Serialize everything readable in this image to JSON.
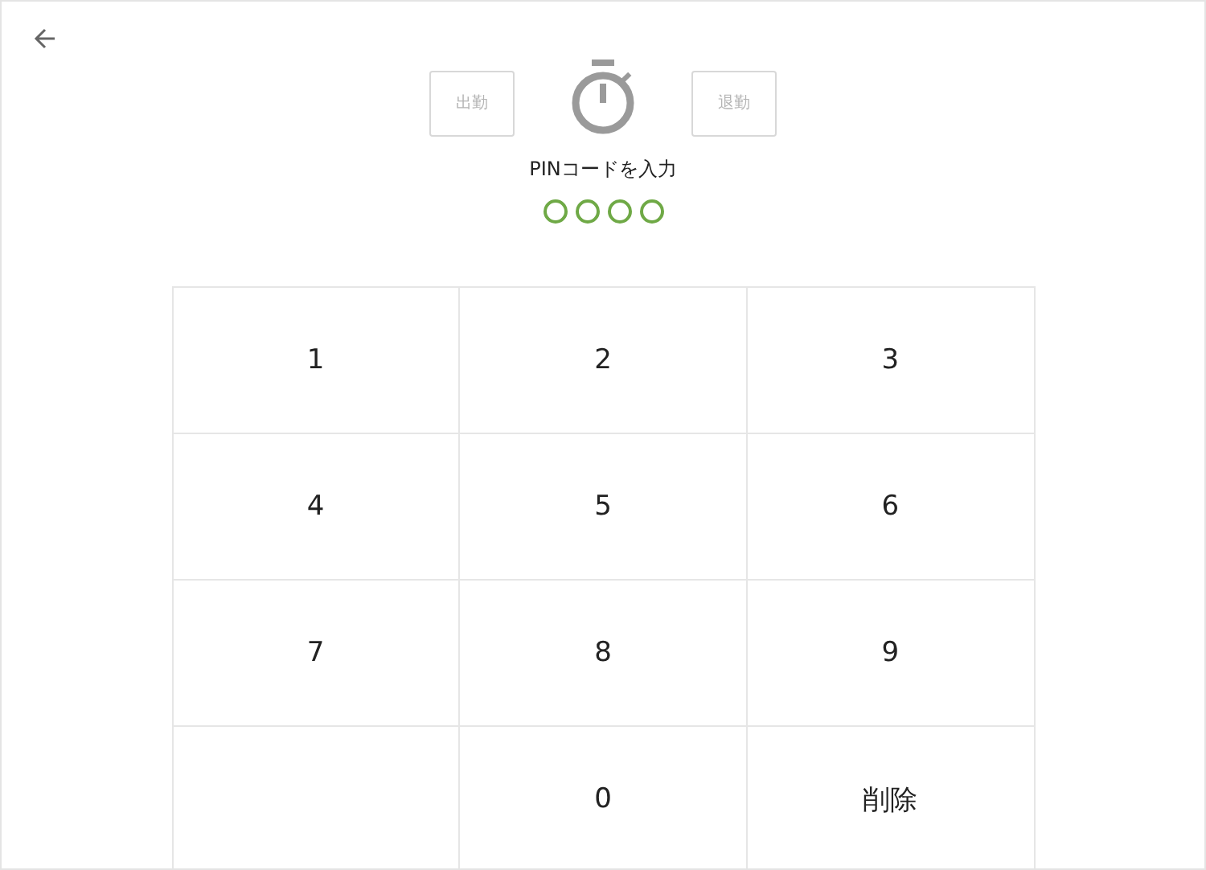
{
  "header": {
    "back": {
      "kind": "arrow"
    },
    "buttons": [
      {
        "label": "出勤",
        "disabled": true
      },
      {
        "label": "退勤",
        "disabled": true
      }
    ]
  },
  "prompt": "PINコードを入力",
  "pin_dots": [
    {
      "filled": false
    },
    {
      "filled": false
    },
    {
      "filled": false
    },
    {
      "filled": false
    }
  ],
  "keypad": [
    {
      "kind": "key",
      "label": "1"
    },
    {
      "kind": "key",
      "label": "2"
    },
    {
      "kind": "key",
      "label": "3"
    },
    {
      "kind": "key",
      "label": "4"
    },
    {
      "kind": "key",
      "label": "5"
    },
    {
      "kind": "key",
      "label": "6"
    },
    {
      "kind": "key",
      "label": "7"
    },
    {
      "kind": "key",
      "label": "8"
    },
    {
      "kind": "key",
      "label": "9"
    },
    {
      "kind": "empty"
    },
    {
      "kind": "key",
      "label": "0"
    },
    {
      "kind": "key",
      "label": "削除"
    }
  ]
}
